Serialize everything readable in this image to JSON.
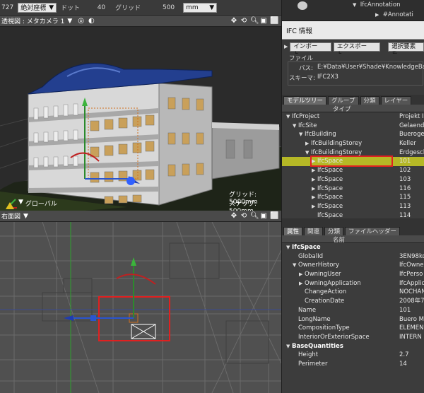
{
  "toolbar": {
    "cursor_value": "727",
    "coord_mode": "絶対座標",
    "dot_label": "ドット",
    "dot_value": "40",
    "grid_label": "グリッド",
    "grid_value": "500",
    "unit": "mm"
  },
  "viewport_top": {
    "title": "透視図 : メタカメラ 1",
    "grid_info": "グリッド: 5000mm",
    "snap_info": "スナップ: 500mm",
    "coord_mode": "グローバル"
  },
  "viewport_bottom": {
    "title": "右面図"
  },
  "right_panel": {
    "browser_items": [
      "IfcAnnotation",
      "#Annotati"
    ],
    "ifc_title": "IFC 情報",
    "import_button": "インポート...",
    "export_button": "エクスポート...",
    "select_button": "選択要素を",
    "file_section": "ファイル",
    "path_label": "パス:",
    "path_value": "E:¥Data¥User¥Shade¥KnowledgeBa",
    "schema_label": "スキーマ:",
    "schema_value": "IFC2X3",
    "model_tabs": [
      "モデルツリー",
      "グループ",
      "分類",
      "レイヤー"
    ],
    "model_col_type": "タイプ",
    "tree": [
      {
        "label": "IfcProject",
        "value": "Projekt I",
        "indent": 0,
        "icon": "down"
      },
      {
        "label": "IfcSite",
        "value": "Gelaende",
        "indent": 1,
        "icon": "down"
      },
      {
        "label": "IfcBuilding",
        "value": "Bueroge",
        "indent": 2,
        "icon": "down"
      },
      {
        "label": "IfcBuildingStorey",
        "value": "Keller",
        "indent": 3,
        "icon": "right"
      },
      {
        "label": "IfcBuildingStorey",
        "value": "Erdgesch",
        "indent": 3,
        "icon": "down"
      },
      {
        "label": "IfcSpace",
        "value": "101",
        "indent": 4,
        "icon": "right",
        "selected": true
      },
      {
        "label": "IfcSpace",
        "value": "102",
        "indent": 4,
        "icon": "right"
      },
      {
        "label": "IfcSpace",
        "value": "103",
        "indent": 4,
        "icon": "right"
      },
      {
        "label": "IfcSpace",
        "value": "116",
        "indent": 4,
        "icon": "right"
      },
      {
        "label": "IfcSpace",
        "value": "115",
        "indent": 4,
        "icon": "right"
      },
      {
        "label": "IfcSpace",
        "value": "113",
        "indent": 4,
        "icon": "right"
      },
      {
        "label": "IfcSpace",
        "value": "114",
        "indent": 4,
        "icon": "none"
      }
    ],
    "prop_tabs": [
      "属性",
      "関連",
      "分類",
      "ファイルヘッダー"
    ],
    "prop_col_name": "名前",
    "properties": [
      {
        "label": "IfcSpace",
        "value": "",
        "indent": 0,
        "icon": "down",
        "bold": true
      },
      {
        "label": "GlobalId",
        "value": "3EN98ko",
        "indent": 1,
        "icon": "none"
      },
      {
        "label": "OwnerHistory",
        "value": "IfcOwner",
        "indent": 1,
        "icon": "down"
      },
      {
        "label": "OwningUser",
        "value": "IfcPerso",
        "indent": 2,
        "icon": "right"
      },
      {
        "label": "OwningApplication",
        "value": "IfcApplic",
        "indent": 2,
        "icon": "right"
      },
      {
        "label": "ChangeAction",
        "value": "NOCHAN",
        "indent": 2,
        "icon": "none"
      },
      {
        "label": "CreationDate",
        "value": "2008年7",
        "indent": 2,
        "icon": "none"
      },
      {
        "label": "Name",
        "value": "101",
        "indent": 1,
        "icon": "none"
      },
      {
        "label": "LongName",
        "value": "Buero M",
        "indent": 1,
        "icon": "none"
      },
      {
        "label": "CompositionType",
        "value": "ELEMEN",
        "indent": 1,
        "icon": "none"
      },
      {
        "label": "InteriorOrExteriorSpace",
        "value": "INTERN",
        "indent": 1,
        "icon": "none"
      },
      {
        "label": "BaseQuantities",
        "value": "",
        "indent": 0,
        "icon": "down",
        "bold": true
      },
      {
        "label": "Height",
        "value": "2.7",
        "indent": 1,
        "icon": "none"
      },
      {
        "label": "Perimeter",
        "value": "14",
        "indent": 1,
        "icon": "none"
      }
    ]
  },
  "colors": {
    "selection": "#b5b826",
    "highlight_box": "#e02020",
    "roof_blue": "#1a3a8a"
  }
}
